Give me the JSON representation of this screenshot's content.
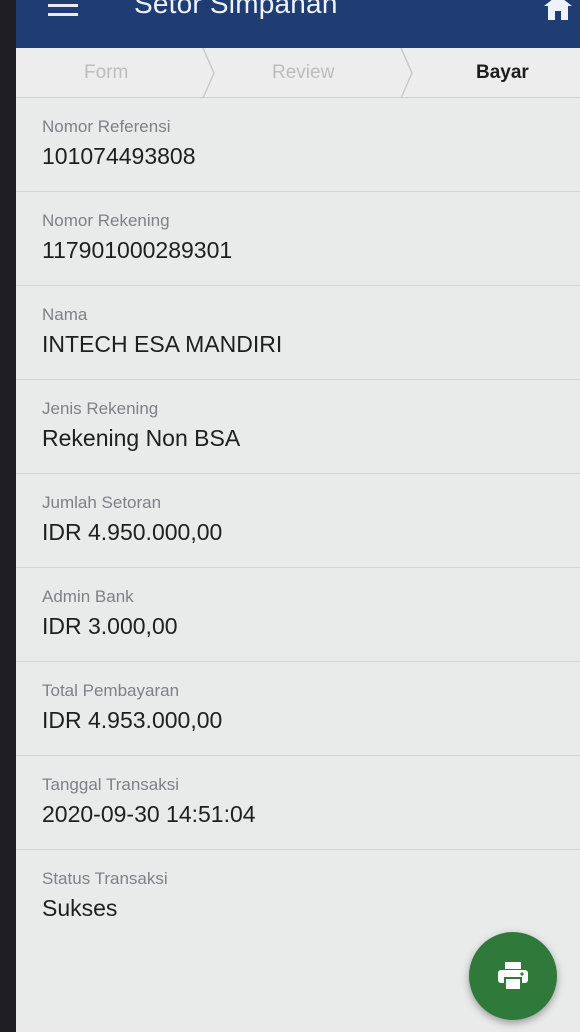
{
  "appbar": {
    "title": "Setor Simpanan",
    "menu_icon": "hamburger-menu-icon",
    "home_icon": "home-icon",
    "color": "#1f3d73"
  },
  "stepper": {
    "steps": [
      {
        "label": "Form",
        "active": false
      },
      {
        "label": "Review",
        "active": false
      },
      {
        "label": "Bayar",
        "active": true
      }
    ]
  },
  "details": [
    {
      "label": "Nomor Referensi",
      "value": "101074493808"
    },
    {
      "label": "Nomor Rekening",
      "value": "117901000289301"
    },
    {
      "label": "Nama",
      "value": "INTECH ESA MANDIRI"
    },
    {
      "label": "Jenis Rekening",
      "value": "Rekening Non BSA"
    },
    {
      "label": "Jumlah Setoran",
      "value": "IDR 4.950.000,00"
    },
    {
      "label": "Admin Bank",
      "value": "IDR 3.000,00"
    },
    {
      "label": "Total Pembayaran",
      "value": "IDR 4.953.000,00"
    },
    {
      "label": "Tanggal Transaksi",
      "value": "2020-09-30 14:51:04"
    },
    {
      "label": "Status Transaksi",
      "value": "Sukses"
    }
  ],
  "fab": {
    "icon": "print-icon",
    "color": "#2f7a3b"
  }
}
